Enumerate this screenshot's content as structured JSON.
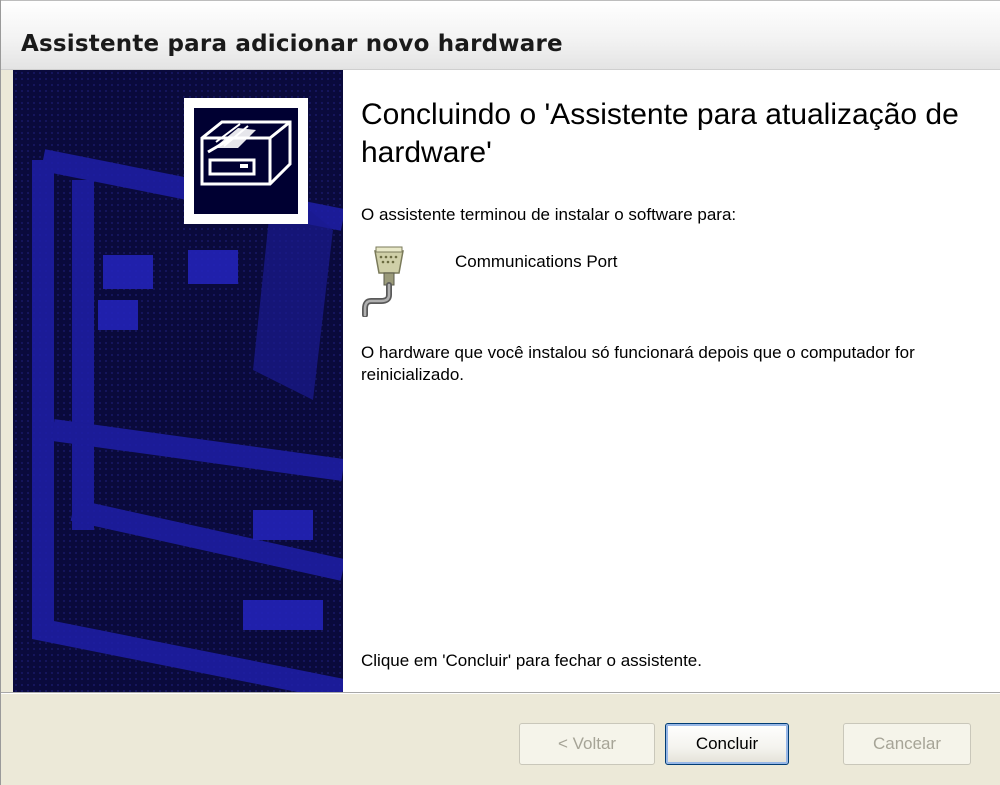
{
  "window": {
    "title": "Assistente para adicionar novo hardware"
  },
  "sidebar": {
    "logo_icon": "hardware-wizard-icon",
    "colors": {
      "background": "#0a0a3c",
      "pattern": "#1f1fa8"
    }
  },
  "main": {
    "heading": "Concluindo o 'Assistente para atualização de hardware'",
    "finished_text": "O assistente terminou de instalar o software para:",
    "device": {
      "icon": "serial-port-icon",
      "name": "Communications Port"
    },
    "restart_notice": "O hardware que você instalou só funcionará depois que o computador for reinicializado.",
    "close_hint": "Clique em 'Concluir' para fechar o assistente."
  },
  "buttons": {
    "back_label": "< Voltar",
    "finish_label": "Concluir",
    "cancel_label": "Cancelar"
  }
}
